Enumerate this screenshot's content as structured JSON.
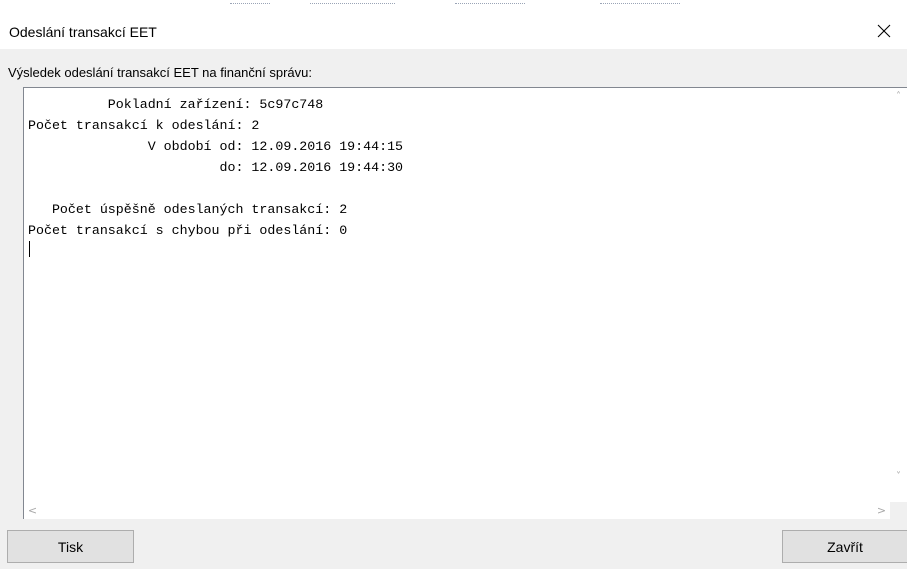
{
  "window": {
    "title": "Odeslání transakcí EET"
  },
  "prompt": "Výsledek odeslání transakcí EET na finanční správu:",
  "log": {
    "lines": [
      "          Pokladní zařízení: 5c97c748",
      "Počet transakcí k odeslání: 2",
      "               V období od: 12.09.2016 19:44:15",
      "                        do: 12.09.2016 19:44:30",
      "",
      "   Počet úspěšně odeslaných transakcí: 2",
      "Počet transakcí s chybou při odeslání: 0"
    ]
  },
  "icons": {
    "close": "close-icon",
    "scroll_up": "chevron-up-icon",
    "scroll_down": "chevron-down-icon",
    "scroll_left": "chevron-left-icon",
    "scroll_right": "chevron-right-icon"
  },
  "buttons": {
    "print_label": "Tisk",
    "close_label": "Zavřít"
  }
}
